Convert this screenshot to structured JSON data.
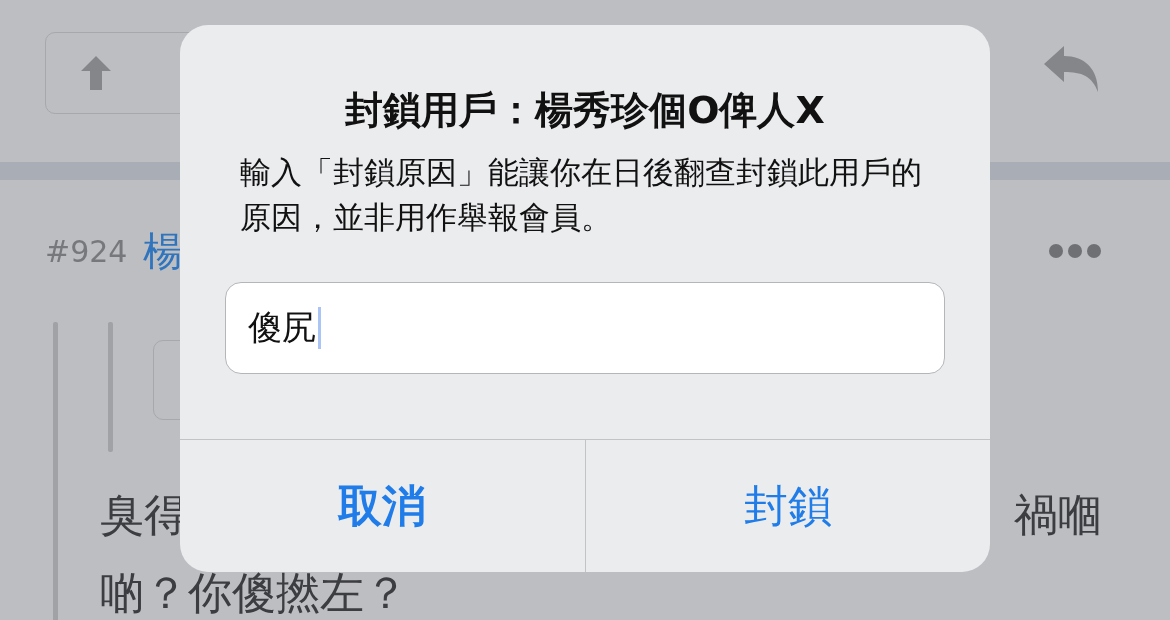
{
  "post": {
    "number": "#924",
    "author": "楊",
    "body_line_1_start": "臭得",
    "body_line_1_end": "禍嗰",
    "body_line_2": "啲？你傻撚左？"
  },
  "alert": {
    "title": "封鎖用戶：楊秀珍個O俾人X",
    "message": "輸入「封鎖原因」能讓你在日後翻查封鎖此用戶的原因，並非用作舉報會員。",
    "field": {
      "value": "傻尻",
      "focused": true
    },
    "buttons": [
      {
        "label": "取消",
        "kind": "cancel"
      },
      {
        "label": "封鎖",
        "kind": "default"
      }
    ]
  }
}
